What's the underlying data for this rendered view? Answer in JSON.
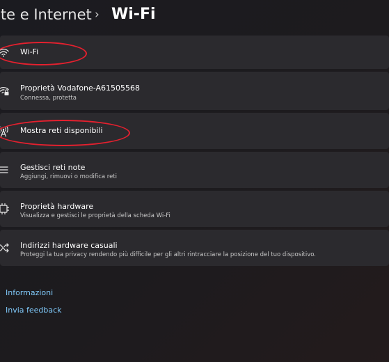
{
  "header": {
    "parent": "ete e Internet",
    "separator": "›",
    "title": "Wi-Fi"
  },
  "items": [
    {
      "label": "Wi-Fi",
      "icon": "wifi-icon"
    },
    {
      "label": "Proprietà Vodafone-A61505568",
      "desc": "Connessa, protetta",
      "icon": "wifi-lock-icon"
    },
    {
      "label": "Mostra reti disponibili",
      "icon": "antenna-icon"
    },
    {
      "label": "Gestisci reti note",
      "desc": "Aggiungi, rimuovi o modifica reti",
      "icon": "list-icon"
    },
    {
      "label": "Proprietà hardware",
      "desc": "Visualizza e gestisci le proprietà della scheda Wi-Fi",
      "icon": "chip-icon"
    },
    {
      "label": "Indirizzi hardware casuali",
      "desc": "Proteggi la tua privacy rendendo più difficile per gli altri rintracciare la posizione del tuo dispositivo.",
      "icon": "shuffle-icon"
    }
  ],
  "links": {
    "info": "Informazioni",
    "feedback": "Invia feedback"
  },
  "colors": {
    "accent_link": "#7fc8f8",
    "annotation": "#e5202e",
    "card": "#2b2a2e"
  }
}
